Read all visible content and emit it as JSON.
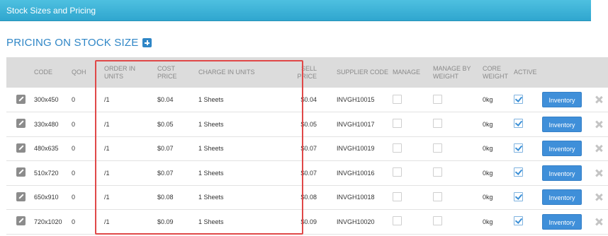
{
  "panel": {
    "title": "Stock Sizes and Pricing"
  },
  "section": {
    "title": "PRICING ON STOCK SIZE",
    "add_icon": "plus-square-icon"
  },
  "table": {
    "columns": {
      "code": "CODE",
      "qoh": "QOH",
      "order_in_units": "ORDER IN UNITS",
      "cost_price": "COST PRICE",
      "charge_in_units": "CHARGE IN UNITS",
      "sell_price": "SELL PRICE",
      "supplier_code": "SUPPLIER CODE",
      "manage": "MANAGE",
      "manage_by_weight": "MANAGE BY WEIGHT",
      "core_weight": "CORE WEIGHT",
      "active": "ACTIVE"
    },
    "rows": [
      {
        "code": "300x450",
        "qoh": "0",
        "order": "/1",
        "cost": "$0.04",
        "charge": "1 Sheets",
        "sell": "$0.04",
        "supplier": "INVGH10015",
        "manage": false,
        "manage_weight": false,
        "core_weight": "0kg",
        "active": true,
        "button": "Inventory"
      },
      {
        "code": "330x480",
        "qoh": "0",
        "order": "/1",
        "cost": "$0.05",
        "charge": "1 Sheets",
        "sell": "$0.05",
        "supplier": "INVGH10017",
        "manage": false,
        "manage_weight": false,
        "core_weight": "0kg",
        "active": true,
        "button": "Inventory"
      },
      {
        "code": "480x635",
        "qoh": "0",
        "order": "/1",
        "cost": "$0.07",
        "charge": "1 Sheets",
        "sell": "$0.07",
        "supplier": "INVGH10019",
        "manage": false,
        "manage_weight": false,
        "core_weight": "0kg",
        "active": true,
        "button": "Inventory"
      },
      {
        "code": "510x720",
        "qoh": "0",
        "order": "/1",
        "cost": "$0.07",
        "charge": "1 Sheets",
        "sell": "$0.07",
        "supplier": "INVGH10016",
        "manage": false,
        "manage_weight": false,
        "core_weight": "0kg",
        "active": true,
        "button": "Inventory"
      },
      {
        "code": "650x910",
        "qoh": "0",
        "order": "/1",
        "cost": "$0.08",
        "charge": "1 Sheets",
        "sell": "$0.08",
        "supplier": "INVGH10018",
        "manage": false,
        "manage_weight": false,
        "core_weight": "0kg",
        "active": true,
        "button": "Inventory"
      },
      {
        "code": "720x1020",
        "qoh": "0",
        "order": "/1",
        "cost": "$0.09",
        "charge": "1 Sheets",
        "sell": "$0.09",
        "supplier": "INVGH10020",
        "manage": false,
        "manage_weight": false,
        "core_weight": "0kg",
        "active": true,
        "button": "Inventory"
      }
    ]
  },
  "colors": {
    "header_bar": "#2fa6cf",
    "accent": "#2f86c6",
    "button": "#3f8fd9",
    "highlight": "#e04848"
  }
}
